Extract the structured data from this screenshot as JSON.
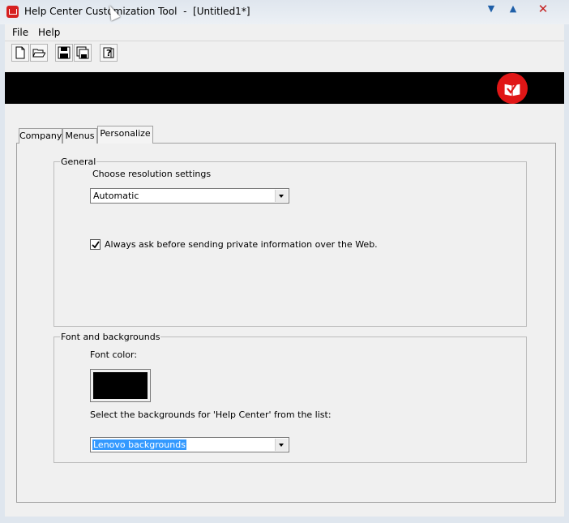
{
  "window": {
    "title": "Help Center Customization Tool  -  [Untitled1*]",
    "controls": {
      "minimize": "▼",
      "maximize": "▲",
      "close": "✕"
    }
  },
  "menu": {
    "file": "File",
    "help": "Help"
  },
  "toolbar": {
    "icons": [
      "new-document-icon",
      "open-folder-icon",
      "save-icon",
      "save-all-icon",
      "help-icon"
    ]
  },
  "tabs": {
    "company": "Company",
    "menus": "Menus",
    "personalize": "Personalize",
    "active": "Personalize"
  },
  "general": {
    "title": "General",
    "resolution_label": "Choose resolution settings",
    "resolution_value": "Automatic",
    "always_ask_label": "Always ask before sending private information over the Web.",
    "always_ask_checked": true
  },
  "fonts": {
    "title": "Font and backgrounds",
    "font_color_label": "Font color:",
    "font_color_value": "#000000",
    "backgrounds_label": "Select the backgrounds for 'Help Center' from the list:",
    "backgrounds_value": "Lenovo backgrounds"
  },
  "colors": {
    "banner": "#000000",
    "logo": "#e01616"
  }
}
